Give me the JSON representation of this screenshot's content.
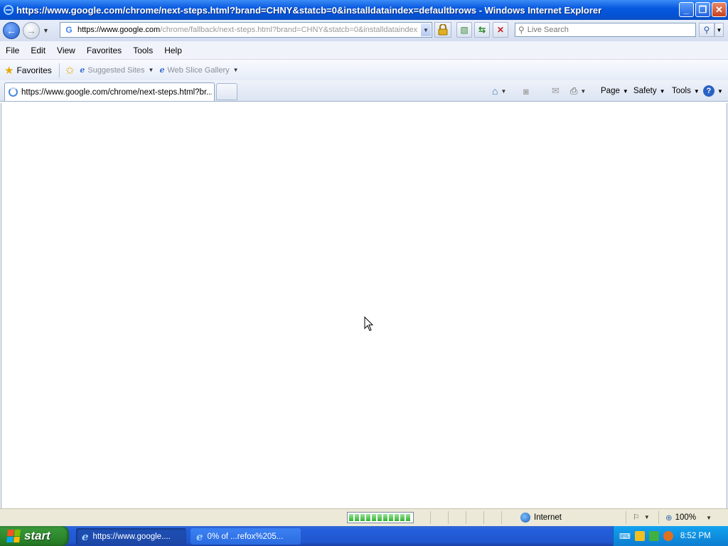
{
  "window": {
    "title": "https://www.google.com/chrome/next-steps.html?brand=CHNY&statcb=0&installdataindex=defaultbrows - Windows Internet Explorer",
    "minimize": "_",
    "maximize": "❐",
    "close": "✕"
  },
  "nav": {
    "back": "←",
    "forward": "→",
    "address_prefix": "https://www.",
    "address_host": "google.com",
    "address_rest": "/chrome/fallback/next-steps.html?brand=CHNY&statcb=0&installdataindex",
    "search_placeholder": "Live Search"
  },
  "menu": [
    "File",
    "Edit",
    "View",
    "Favorites",
    "Tools",
    "Help"
  ],
  "favorites": {
    "label": "Favorites",
    "links": [
      "Suggested Sites",
      "Web Slice Gallery"
    ]
  },
  "tabs": {
    "active_label": "https://www.google.com/chrome/next-steps.html?br..."
  },
  "commandbar": {
    "page": "Page",
    "safety": "Safety",
    "tools": "Tools",
    "help": "?"
  },
  "status": {
    "progress_fraction": 1.0,
    "zone": "Internet",
    "zoom": "100%"
  },
  "taskbar": {
    "start_label": "start",
    "task1": "https://www.google....",
    "task2": "0% of ...refox%205...",
    "clock": "8:52 PM"
  },
  "colors": {
    "titlebar": "#0a5ae0",
    "taskbar": "#245edb",
    "start": "#2e8b2e",
    "progress": "#2fb12f"
  }
}
